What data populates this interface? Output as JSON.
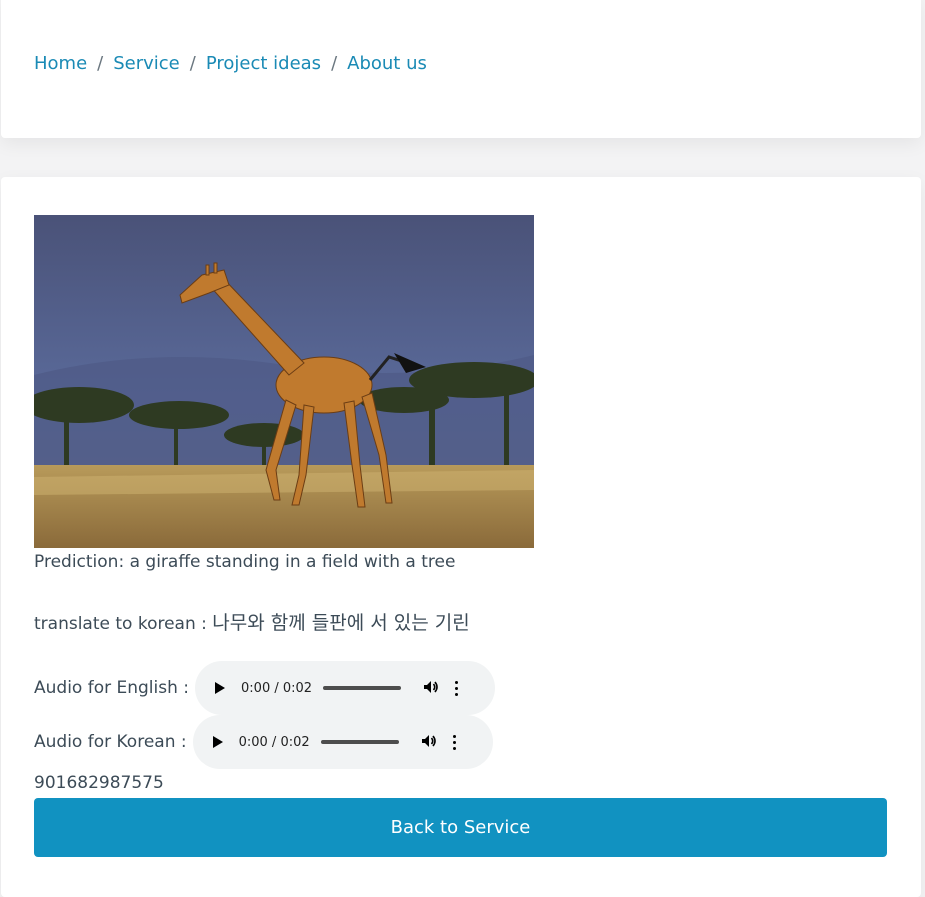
{
  "breadcrumb": {
    "items": [
      "Home",
      "Service",
      "Project ideas",
      "About us"
    ],
    "separator": "/"
  },
  "result": {
    "image_alt": "giraffe",
    "prediction": "Prediction: a giraffe standing in a field with a tree",
    "translate_label": "translate to korean : ",
    "translate_text": "나무와 함께 들판에 서 있는 기린"
  },
  "audio": {
    "english_label": "Audio for English :",
    "korean_label": "Audio for Korean :",
    "english_time": "0:00 / 0:02",
    "korean_time": "0:00 / 0:02"
  },
  "record_id": "901682987575",
  "back_button_label": "Back to Service",
  "colors": {
    "link": "#1a8ab5",
    "button": "#1192c1",
    "player_bg": "#f1f3f4"
  }
}
